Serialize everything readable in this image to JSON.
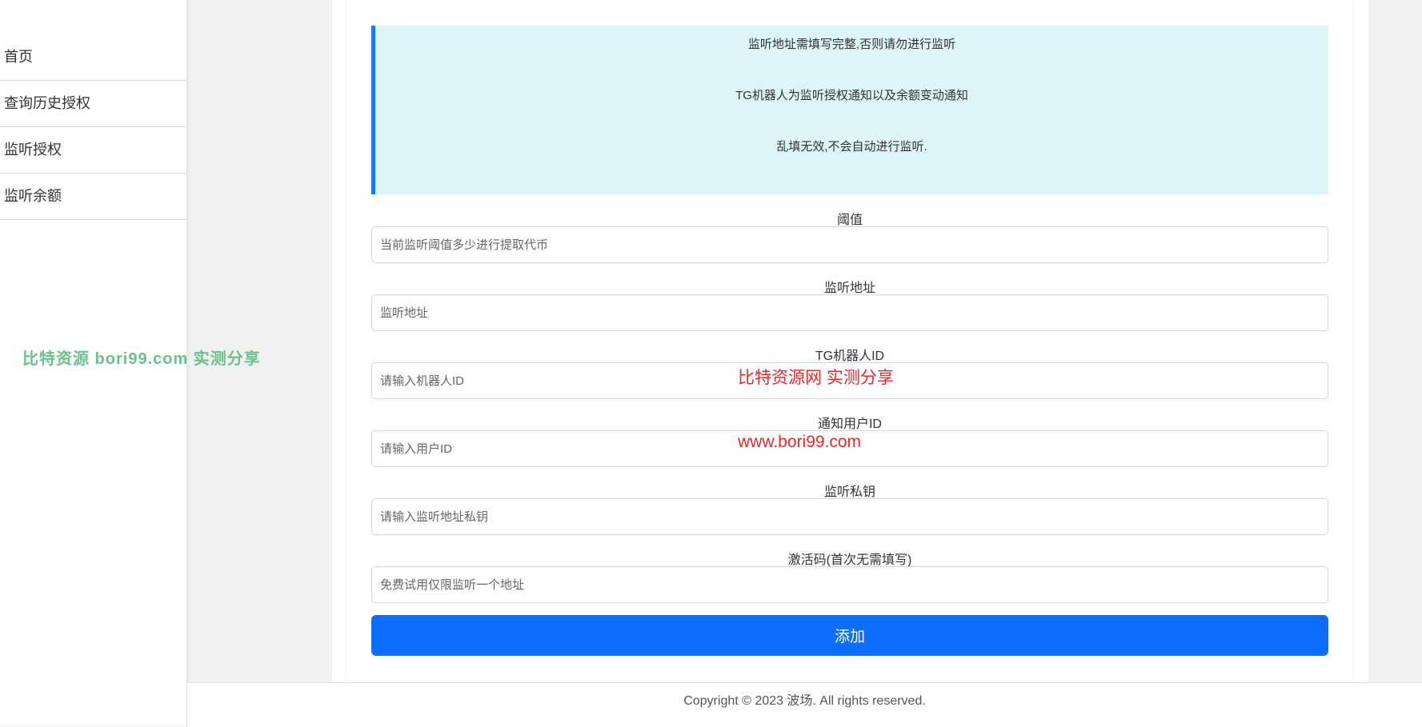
{
  "sidebar": {
    "items": [
      {
        "label": "首页"
      },
      {
        "label": "查询历史授权"
      },
      {
        "label": "监听授权"
      },
      {
        "label": "监听余额"
      }
    ]
  },
  "notice": {
    "lines": [
      "监听地址需填写完整,否则请勿进行监听",
      "TG机器人为监听授权通知以及余额变动通知",
      "乱填无效,不会自动进行监听."
    ]
  },
  "form": {
    "threshold": {
      "label": "阈值",
      "placeholder": "当前监听阈值多少进行提取代币"
    },
    "address": {
      "label": "监听地址",
      "placeholder": "监听地址"
    },
    "bot_id": {
      "label": "TG机器人ID",
      "placeholder": "请输入机器人ID"
    },
    "user_id": {
      "label": "通知用户ID",
      "placeholder": "请输入用户ID"
    },
    "private_key": {
      "label": "监听私钥",
      "placeholder": "请输入监听地址私钥"
    },
    "activation_code": {
      "label": "激活码(首次无需填写)",
      "placeholder": "免费试用仅限监听一个地址"
    },
    "submit_label": "添加"
  },
  "watermarks": {
    "green": "比特资源 bori99.com 实测分享",
    "red_1": "比特资源网  实测分享",
    "red_2": "www.bori99.com"
  },
  "footer": {
    "copyright": "Copyright © 2023 波场. All rights reserved."
  },
  "colors": {
    "primary": "#0d6efd",
    "notice_bg": "#ddf5f7",
    "notice_border": "#1677ff",
    "watermark_green": "#6cc18c",
    "watermark_red": "#e62a2a"
  }
}
